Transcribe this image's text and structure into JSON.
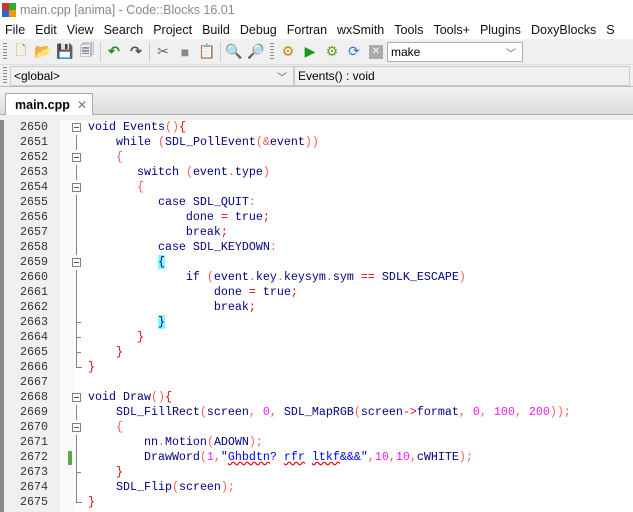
{
  "window": {
    "title": "main.cpp [anima] - Code::Blocks 16.01"
  },
  "menu": [
    "File",
    "Edit",
    "View",
    "Search",
    "Project",
    "Build",
    "Debug",
    "Fortran",
    "wxSmith",
    "Tools",
    "Tools+",
    "Plugins",
    "DoxyBlocks",
    "S"
  ],
  "toolbar": {
    "icons": [
      "new-file-icon",
      "open-icon",
      "save-icon",
      "save-all-icon",
      "undo-icon",
      "redo-icon",
      "cut-icon",
      "copy-icon",
      "paste-icon",
      "find-icon",
      "replace-icon",
      "build-icon",
      "run-icon",
      "build-run-icon",
      "rebuild-icon",
      "abort-icon"
    ],
    "target": "make"
  },
  "scope": {
    "global": "<global>",
    "function": "Events() : void"
  },
  "tabs": [
    {
      "label": "main.cpp",
      "close": "✕"
    }
  ],
  "colors": {
    "keyword": "#00008b",
    "operator": "#e00000",
    "number": "#f020f0",
    "string": "#0000ff",
    "brace_highlight": "#80ffff",
    "changed_marker": "#5caa46"
  },
  "lines": [
    {
      "n": "2650",
      "fold": "box",
      "t": [
        [
          "void",
          "kw"
        ],
        [
          " Events",
          "id"
        ],
        [
          "()",
          "pn"
        ],
        [
          "{",
          "op"
        ]
      ]
    },
    {
      "n": "2651",
      "fold": "line",
      "t": [
        [
          "    while",
          "kw"
        ],
        [
          " ",
          "id"
        ],
        [
          "(",
          "pn"
        ],
        [
          "SDL_PollEvent",
          "id"
        ],
        [
          "(&",
          "pn"
        ],
        [
          "event",
          "id"
        ],
        [
          "))",
          "pn"
        ]
      ]
    },
    {
      "n": "2652",
      "fold": "box",
      "t": [
        [
          "    {",
          "pn"
        ]
      ]
    },
    {
      "n": "2653",
      "fold": "line",
      "t": [
        [
          "       switch",
          "kw"
        ],
        [
          " ",
          "id"
        ],
        [
          "(",
          "pn"
        ],
        [
          "event",
          "id"
        ],
        [
          ".",
          "pn"
        ],
        [
          "type",
          "id"
        ],
        [
          ")",
          "pn"
        ]
      ]
    },
    {
      "n": "2654",
      "fold": "box",
      "t": [
        [
          "       {",
          "pn"
        ]
      ]
    },
    {
      "n": "2655",
      "fold": "line",
      "t": [
        [
          "          case",
          "kw"
        ],
        [
          " SDL_QUIT",
          "id"
        ],
        [
          ":",
          "pn"
        ]
      ]
    },
    {
      "n": "2656",
      "fold": "line",
      "t": [
        [
          "              done ",
          "id"
        ],
        [
          "=",
          "op"
        ],
        [
          " true",
          "kw"
        ],
        [
          ";",
          "op"
        ]
      ]
    },
    {
      "n": "2657",
      "fold": "line",
      "t": [
        [
          "              break",
          "kw"
        ],
        [
          ";",
          "op"
        ]
      ]
    },
    {
      "n": "2658",
      "fold": "line",
      "t": [
        [
          "          case",
          "kw"
        ],
        [
          " SDL_KEYDOWN",
          "id"
        ],
        [
          ":",
          "pn"
        ]
      ]
    },
    {
      "n": "2659",
      "fold": "box",
      "t": [
        [
          "          ",
          "id"
        ],
        [
          "{",
          "hl"
        ]
      ]
    },
    {
      "n": "2660",
      "fold": "line",
      "t": [
        [
          "              if",
          "kw"
        ],
        [
          " ",
          "id"
        ],
        [
          "(",
          "pn"
        ],
        [
          "event",
          "id"
        ],
        [
          ".",
          "pn"
        ],
        [
          "key",
          "id"
        ],
        [
          ".",
          "pn"
        ],
        [
          "keysym",
          "id"
        ],
        [
          ".",
          "pn"
        ],
        [
          "sym ",
          "id"
        ],
        [
          "==",
          "op"
        ],
        [
          " SDLK_ESCAPE",
          "id"
        ],
        [
          ")",
          "pn"
        ]
      ]
    },
    {
      "n": "2661",
      "fold": "line",
      "t": [
        [
          "                  done ",
          "id"
        ],
        [
          "=",
          "op"
        ],
        [
          " true",
          "kw"
        ],
        [
          ";",
          "op"
        ]
      ]
    },
    {
      "n": "2662",
      "fold": "line",
      "t": [
        [
          "                  break",
          "kw"
        ],
        [
          ";",
          "op"
        ]
      ]
    },
    {
      "n": "2663",
      "fold": "tick",
      "t": [
        [
          "          ",
          "id"
        ],
        [
          "}",
          "hl"
        ]
      ]
    },
    {
      "n": "2664",
      "fold": "tick",
      "t": [
        [
          "       }",
          "op"
        ]
      ]
    },
    {
      "n": "2665",
      "fold": "tick",
      "t": [
        [
          "    }",
          "op"
        ]
      ]
    },
    {
      "n": "2666",
      "fold": "end",
      "t": [
        [
          "}",
          "op"
        ]
      ]
    },
    {
      "n": "2667",
      "fold": "none",
      "t": []
    },
    {
      "n": "2668",
      "fold": "box",
      "t": [
        [
          "void",
          "kw"
        ],
        [
          " Draw",
          "id"
        ],
        [
          "()",
          "pn"
        ],
        [
          "{",
          "op"
        ]
      ]
    },
    {
      "n": "2669",
      "fold": "line",
      "t": [
        [
          "    SDL_FillRect",
          "id"
        ],
        [
          "(",
          "pn"
        ],
        [
          "screen",
          "id"
        ],
        [
          ", ",
          "pn"
        ],
        [
          "0",
          "num"
        ],
        [
          ", ",
          "pn"
        ],
        [
          "SDL_MapRGB",
          "id"
        ],
        [
          "(",
          "pn"
        ],
        [
          "screen",
          "id"
        ],
        [
          "->",
          "op"
        ],
        [
          "format",
          "id"
        ],
        [
          ", ",
          "pn"
        ],
        [
          "0",
          "num"
        ],
        [
          ", ",
          "pn"
        ],
        [
          "100",
          "num"
        ],
        [
          ", ",
          "pn"
        ],
        [
          "200",
          "num"
        ],
        [
          "));",
          "pn"
        ]
      ]
    },
    {
      "n": "2670",
      "fold": "box",
      "t": [
        [
          "    {",
          "pn"
        ]
      ]
    },
    {
      "n": "2671",
      "fold": "line",
      "t": [
        [
          "        nn",
          "id"
        ],
        [
          ".",
          "pn"
        ],
        [
          "Motion",
          "id"
        ],
        [
          "(",
          "pn"
        ],
        [
          "ADOWN",
          "id"
        ],
        [
          ");",
          "pn"
        ]
      ]
    },
    {
      "n": "2672",
      "fold": "line",
      "changed": true,
      "t": [
        [
          "        DrawWord",
          "id"
        ],
        [
          "(",
          "pn"
        ],
        [
          "1",
          "num"
        ],
        [
          ",",
          "pn"
        ],
        [
          "\"",
          "str"
        ],
        [
          "Ghbdtn",
          "str sq"
        ],
        [
          "? ",
          "str"
        ],
        [
          "rfr",
          "str sq"
        ],
        [
          " ",
          "str"
        ],
        [
          "ltkf",
          "str sq"
        ],
        [
          "&&&\"",
          "str"
        ],
        [
          ",",
          "pn"
        ],
        [
          "10",
          "num"
        ],
        [
          ",",
          "pn"
        ],
        [
          "10",
          "num"
        ],
        [
          ",",
          "pn"
        ],
        [
          "cWHITE",
          "id"
        ],
        [
          ");",
          "pn"
        ]
      ]
    },
    {
      "n": "2673",
      "fold": "tick",
      "t": [
        [
          "    }",
          "op"
        ]
      ]
    },
    {
      "n": "2674",
      "fold": "line",
      "t": [
        [
          "    SDL_Flip",
          "id"
        ],
        [
          "(",
          "pn"
        ],
        [
          "screen",
          "id"
        ],
        [
          ");",
          "pn"
        ]
      ]
    },
    {
      "n": "2675",
      "fold": "end",
      "t": [
        [
          "}",
          "op"
        ]
      ]
    }
  ]
}
